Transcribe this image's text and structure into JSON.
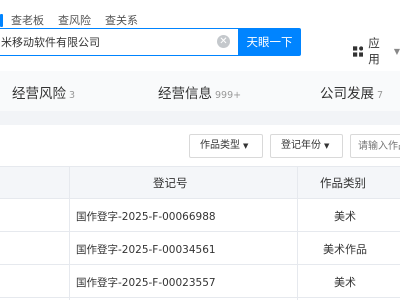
{
  "search": {
    "tabs": [
      "查老板",
      "查风险",
      "查关系"
    ],
    "query": "米移动软件有限公司",
    "button_label": "天眼一下"
  },
  "apps": {
    "label": "应用",
    "icon": "grid-icon"
  },
  "section_tabs": [
    {
      "label": "经营风险",
      "count": "3"
    },
    {
      "label": "经营信息",
      "count": "999+"
    },
    {
      "label": "公司发展",
      "count": "7"
    }
  ],
  "filters": {
    "work_type": "作品类型",
    "reg_year": "登记年份",
    "search_placeholder": "请输入作品名称"
  },
  "table": {
    "headers": {
      "reg_no": "登记号",
      "category": "作品类别"
    },
    "rows": [
      {
        "reg_no": "国作登字-2025-F-00066988",
        "category": "美术"
      },
      {
        "reg_no": "国作登字-2025-F-00034561",
        "category": "美术作品"
      },
      {
        "reg_no": "国作登字-2025-F-00023557",
        "category": "美术"
      }
    ]
  },
  "colors": {
    "accent": "#0084ff",
    "page_bg": "#f2f4f7",
    "table_header_bg": "#f4f6f9"
  }
}
